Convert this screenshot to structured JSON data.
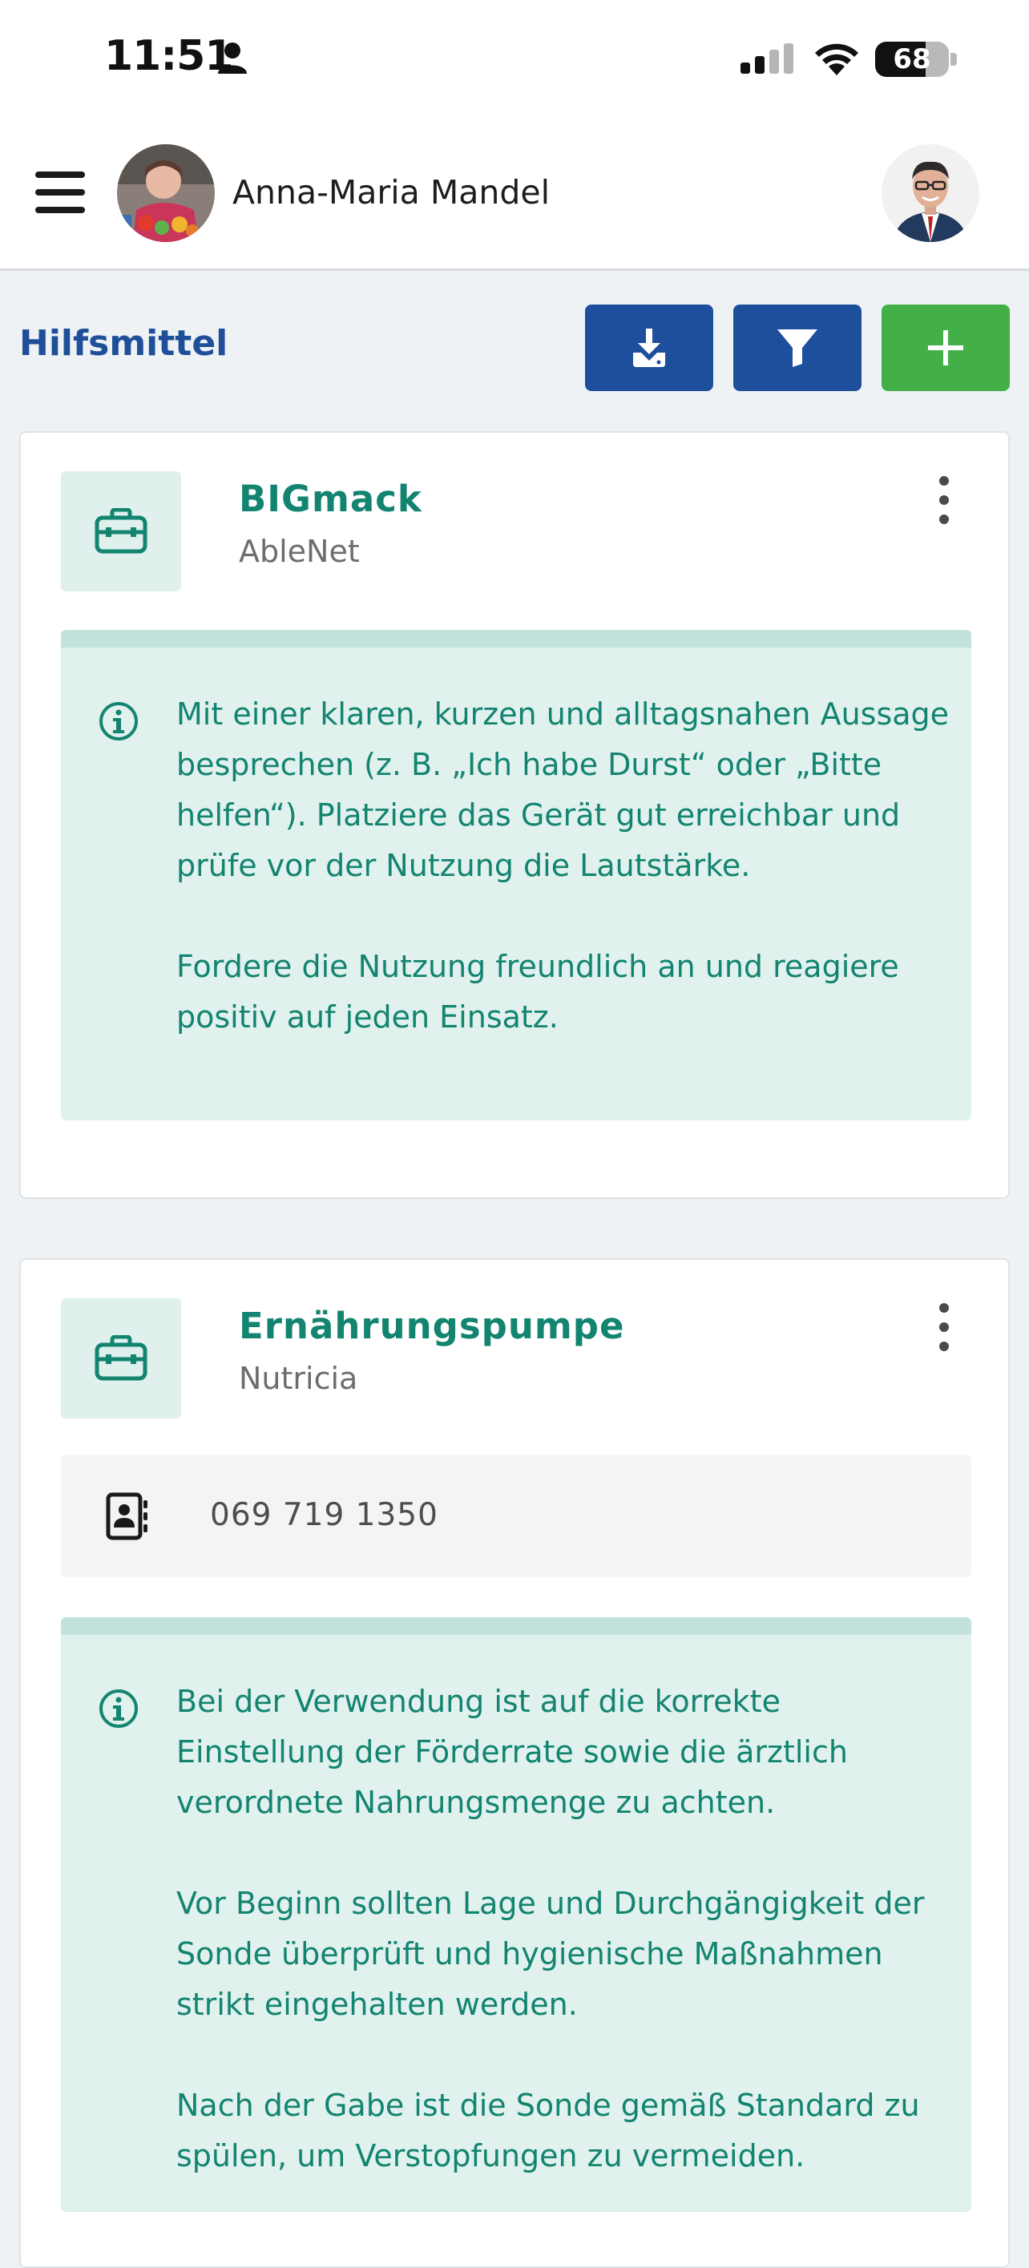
{
  "status_bar": {
    "time": "11:51",
    "battery": "68",
    "battery_level": 0.68
  },
  "header": {
    "patient_name": "Anna-Maria Mandel"
  },
  "toolbar": {
    "title": "Hilfsmittel"
  },
  "cards": [
    {
      "title": "BIGmack",
      "subtitle": "AbleNet",
      "info": "Mit einer klaren, kurzen und alltagsnahen Aussage besprechen (z. B. „Ich habe Durst“ oder „Bitte helfen“). Platziere das Gerät gut erreichbar und prüfe vor der Nutzung die Lautstärke.\n\nFordere die Nutzung freundlich an und reagiere positiv auf jeden Einsatz."
    },
    {
      "title": "Ernährungspumpe",
      "subtitle": "Nutricia",
      "contact": "069 719 1350",
      "info": "Bei der Verwendung ist auf die korrekte Einstellung der Förderrate sowie die ärztlich verordnete Nahrungsmenge zu achten.\n\nVor Beginn sollten Lage und Durchgängigkeit der Sonde überprüft und hygienische Maßnahmen strikt eingehalten werden.\n\nNach der Gabe ist die Sonde gemäß Standard zu spülen, um Verstopfungen zu vermeiden."
    }
  ],
  "colors": {
    "primary_blue": "#1e4f9c",
    "add_green": "#43b047",
    "teal_text": "#128470",
    "info_bg": "#e1f1ee"
  },
  "icons": {
    "menu": "hamburger-icon",
    "download": "download-icon",
    "filter": "filter-icon",
    "add": "plus-icon",
    "card": "toolbox-icon",
    "more": "kebab-icon",
    "info": "info-circle-icon",
    "contact": "contact-book-icon"
  }
}
